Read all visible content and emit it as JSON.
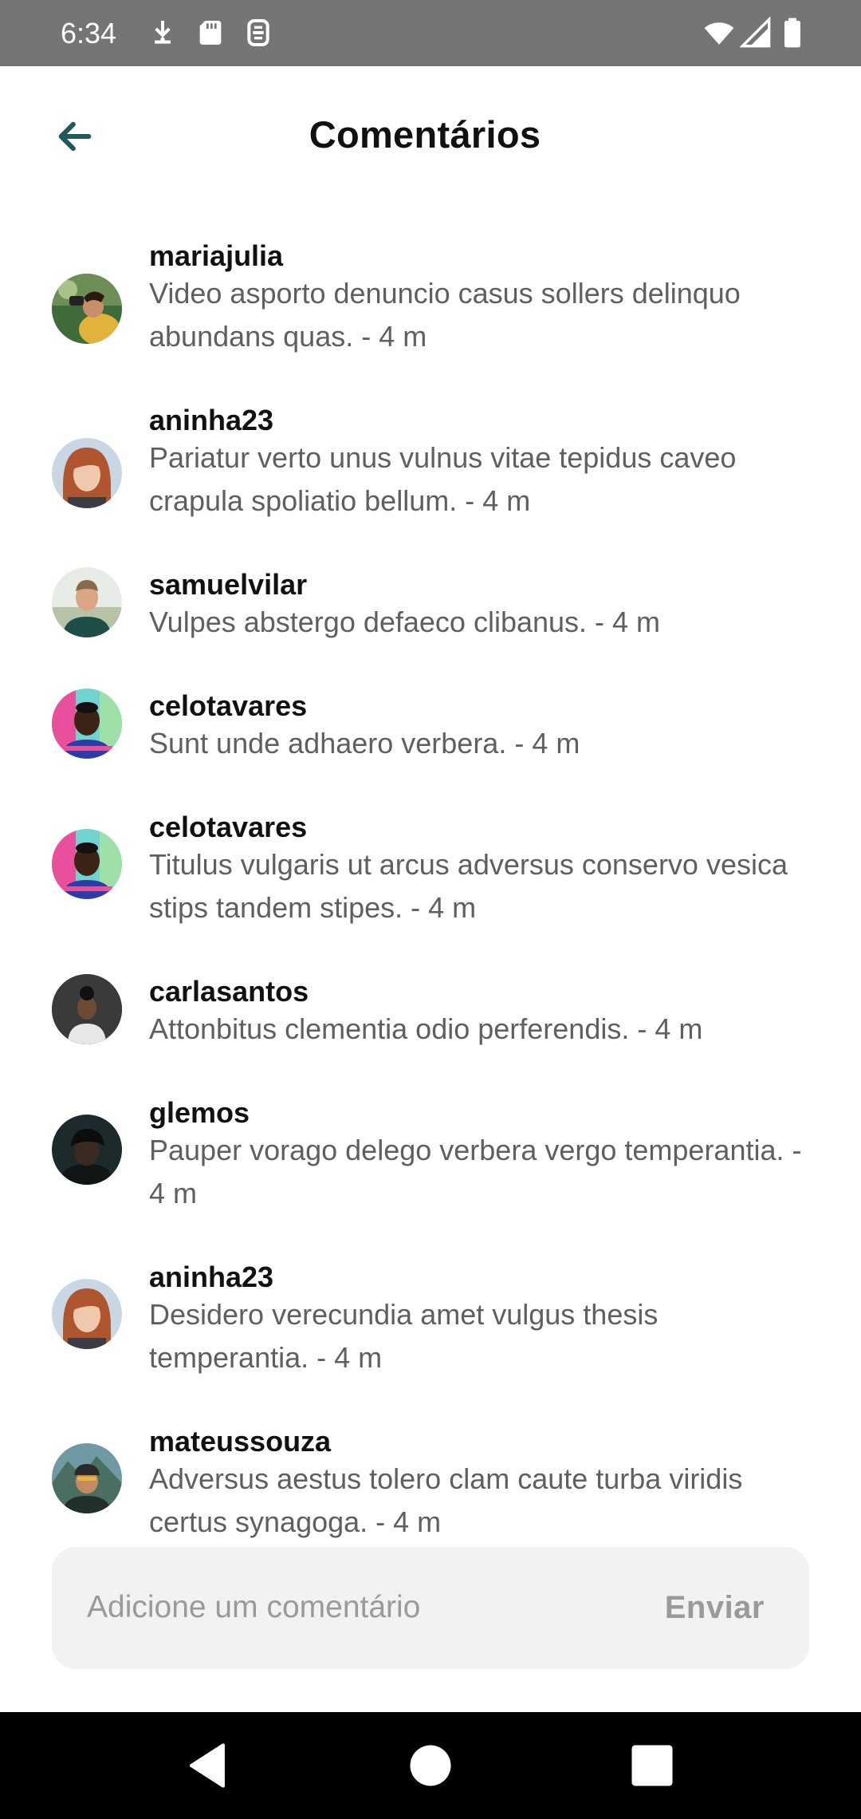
{
  "status_bar": {
    "time": "6:34",
    "left_icons": [
      "download-icon",
      "sd-card-icon",
      "screen-record-icon"
    ],
    "right_icons": [
      "wifi-icon",
      "signal-icon",
      "battery-icon"
    ]
  },
  "header": {
    "title": "Comentários",
    "back_icon": "arrow-left-icon",
    "accent_color": "#1e5a5a"
  },
  "comments": [
    {
      "user": "mariajulia",
      "text": "Video asporto denuncio casus sollers delinquo abundans quas. - 4 m"
    },
    {
      "user": "aninha23",
      "text": "Pariatur verto unus vulnus vitae tepidus caveo crapula spoliatio bellum. - 4 m"
    },
    {
      "user": "samuelvilar",
      "text": "Vulpes abstergo defaeco clibanus. - 4 m"
    },
    {
      "user": "celotavares",
      "text": "Sunt unde adhaero verbera. - 4 m"
    },
    {
      "user": "celotavares",
      "text": "Titulus vulgaris ut arcus adversus conservo vesica stips tandem stipes. - 4 m"
    },
    {
      "user": "carlasantos",
      "text": "Attonbitus clementia odio perferendis. - 4 m"
    },
    {
      "user": "glemos",
      "text": "Pauper vorago delego verbera vergo temperantia. - 4 m"
    },
    {
      "user": "aninha23",
      "text": "Desidero verecundia amet vulgus thesis temperantia. - 4 m"
    },
    {
      "user": "mateussouza",
      "text": "Adversus aestus tolero clam caute turba viridis certus synagoga. - 4 m"
    }
  ],
  "composer": {
    "placeholder": "Adicione um comentário",
    "value": "",
    "send_label": "Enviar"
  },
  "nav_bar": {
    "buttons": [
      "back-triangle-icon",
      "home-circle-icon",
      "recents-square-icon"
    ]
  }
}
